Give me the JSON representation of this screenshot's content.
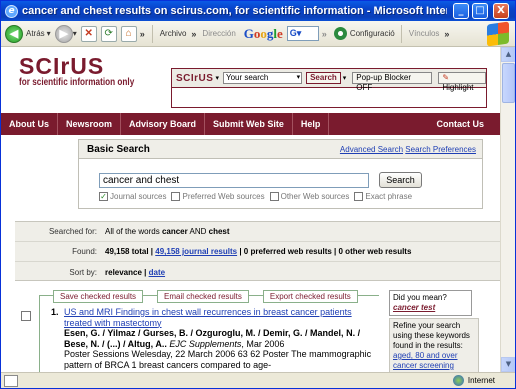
{
  "window": {
    "title": "cancer and chest results on scirus.com, for scientific information - Microsoft Internet E...",
    "controls": {
      "minimize": "_",
      "maximize": "□",
      "close": "X"
    }
  },
  "toolbar": {
    "back_label": "Atrás",
    "archivo_label": "Archivo",
    "direccion_label": "Dirección",
    "google_box": "G▾",
    "configuracion_label": "Configuració",
    "vinculos_label": "Vínculos"
  },
  "page": {
    "logo": {
      "mark": "SCIrUS",
      "tagline": "for scientific information only"
    },
    "searchbar": {
      "mini_logo": "SCIrUS",
      "select_value": "Your search",
      "search_button": "Search",
      "popup_label": "Pop-up Blocker OFF",
      "highlight_label": "Highlight"
    },
    "nav": [
      "About Us",
      "Newsroom",
      "Advisory Board",
      "Submit Web Site",
      "Help"
    ],
    "nav_contact": "Contact Us",
    "basic_search": {
      "heading": "Basic Search",
      "advanced_link": "Advanced Search",
      "preferences_link": "Search Preferences",
      "query": "cancer and chest",
      "button": "Search",
      "options": [
        "Journal sources",
        "Preferred Web sources",
        "Other Web sources",
        "Exact phrase"
      ]
    },
    "summary": {
      "searched_for_label": "Searched for:",
      "searched_for_pre": "All of the words",
      "term1": "cancer",
      "and_word": "AND",
      "term2": "chest",
      "found_label": "Found:",
      "found_total": "49,158 total",
      "found_journal": "49,158 journal results",
      "found_rest": "| 0 preferred web results | 0 other web results",
      "sort_label": "Sort by:",
      "sort_relevance": "relevance",
      "sort_date": "date"
    },
    "result_actions": [
      "Save checked results",
      "Email checked results",
      "Export checked results"
    ],
    "result1": {
      "number": "1.",
      "title": "US and MRI Findings in chest wall recurrences in breast cancer patients treated with mastectomy",
      "authors": "Esen, G. / Yilmaz / Gurses, B. / Ozguroglu, M. / Demir, G. / Mandel, N. / Bese, N. / (...) / Altug, A..",
      "source": "EJC Supplements",
      "date": ", Mar 2006",
      "snippet": "Poster Sessions Welesday, 22 March 2006 63 62 Poster The mammographic pattern of BRCA 1 breast cancers compared to age-"
    },
    "did_you_mean": {
      "label": "Did you mean?",
      "suggestion": "cancer test"
    },
    "refine": {
      "text": "Refine your search using these keywords found in the results:",
      "links": [
        "aged, 80 and over",
        "cancer screening"
      ]
    }
  },
  "status": {
    "zone": "Internet"
  }
}
